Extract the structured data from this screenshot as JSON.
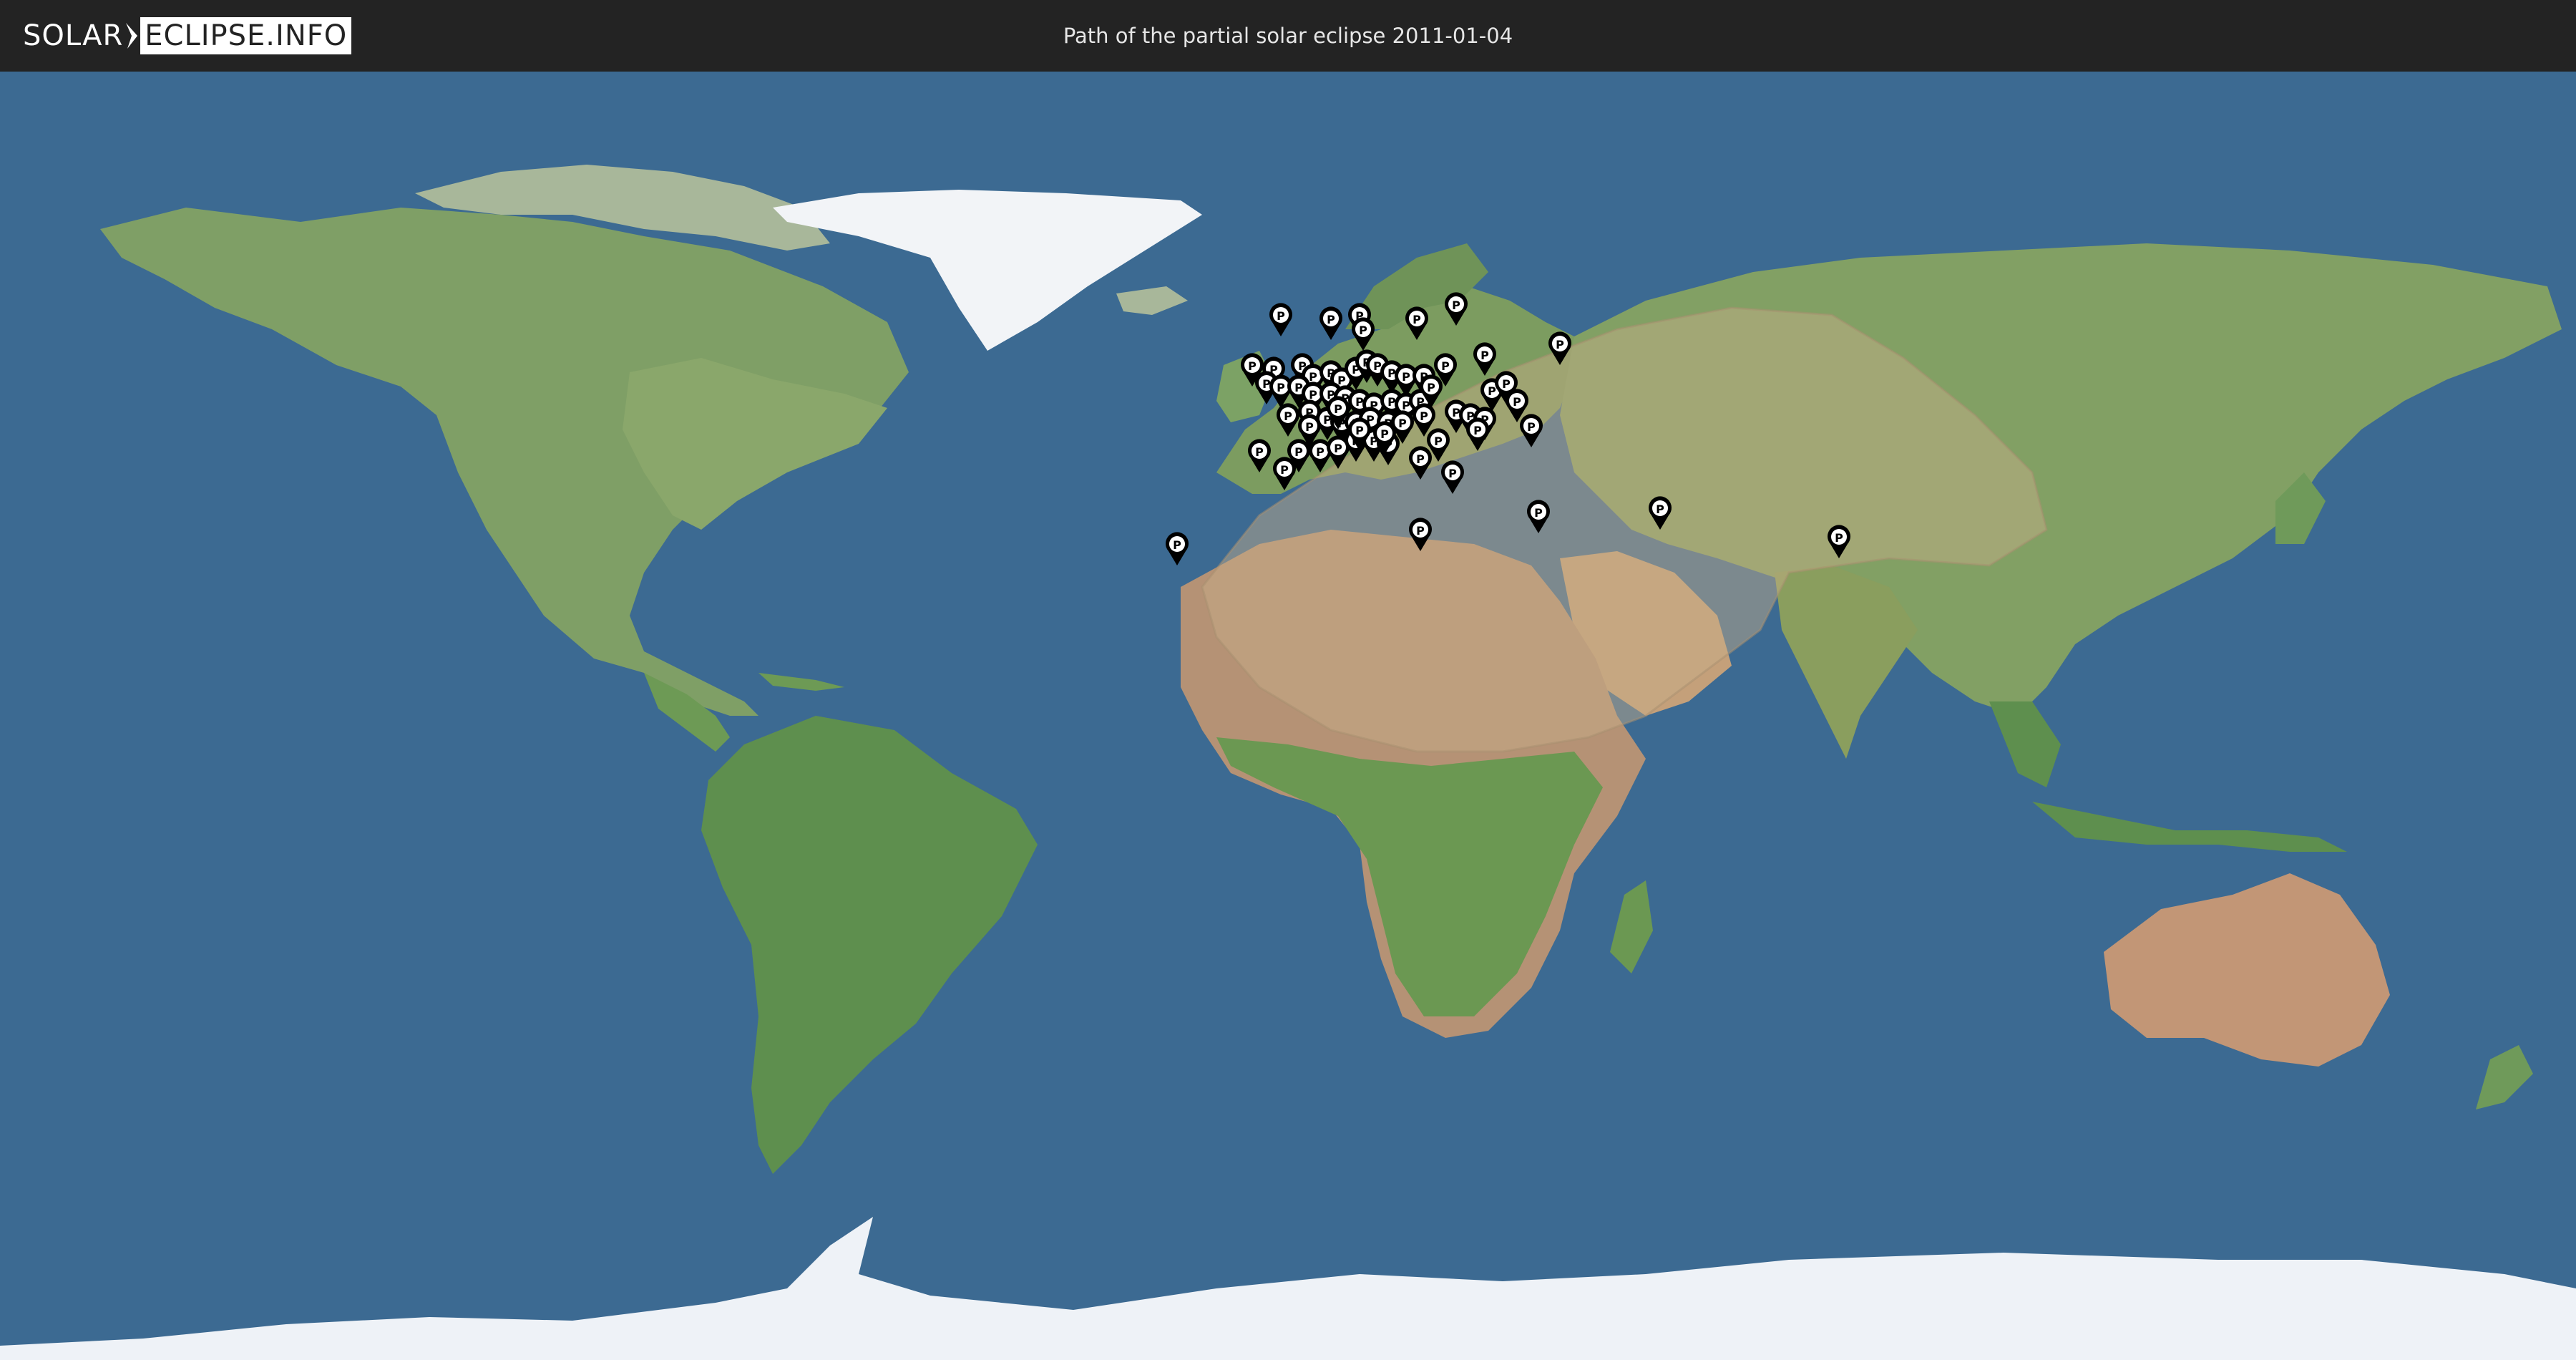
{
  "header": {
    "logo_left": "SOLAR",
    "logo_right": "ECLIPSE.INFO",
    "title": "Path of the partial solar eclipse 2011-01-04"
  },
  "map": {
    "projection": "equirectangular world map",
    "eclipse": {
      "date": "2011-01-04",
      "type": "partial"
    },
    "marker_icon": "map-pin-icon",
    "marker_letter": "P",
    "colors": {
      "ocean": "#3c6a92",
      "land_green": "#6f9a5a",
      "land_desert": "#b49072",
      "ice": "#eef2f7",
      "eclipse_overlay": "#c9b08a",
      "marker": "#000000",
      "header": "#232323"
    }
  }
}
